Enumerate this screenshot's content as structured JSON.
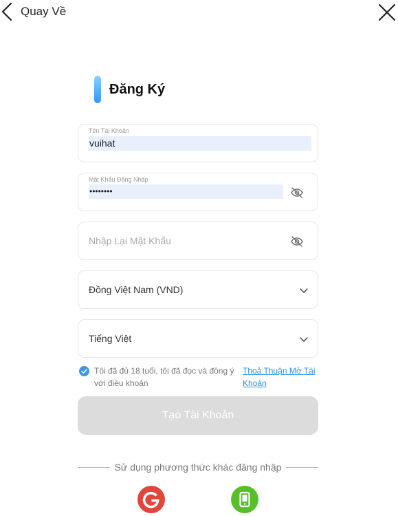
{
  "header": {
    "back_label": "Quay Về"
  },
  "page": {
    "title": "Đăng Ký"
  },
  "form": {
    "username": {
      "label": "Tên Tài Khoản",
      "value": "vuihat"
    },
    "password": {
      "label": "Mật Khẩu Đăng Nhập",
      "value": "••••••••"
    },
    "confirm_password": {
      "placeholder": "Nhập Lại Mật Khẩu"
    },
    "currency": {
      "selected": "Đồng Việt Nam (VND)"
    },
    "language": {
      "selected": "Tiếng Việt"
    }
  },
  "terms": {
    "checked": true,
    "text": "Tôi đã đủ 18 tuổi, tôi đã đọc và đồng ý với điều khoản",
    "link": "Thoả Thuận Mở Tài Khoản"
  },
  "submit": {
    "label": "Tạo Tài Khoản"
  },
  "alt_login": {
    "label": "Sử dụng phương thức khác đăng nhập",
    "google_icon": "google-icon",
    "phone_icon": "phone-icon"
  },
  "colors": {
    "accent": "#2f97f0",
    "link": "#2f8fe6",
    "button_disabled": "#dcdcdc",
    "google": "#e0463a",
    "phone": "#56c02a",
    "autofill": "#e8f0fe"
  }
}
